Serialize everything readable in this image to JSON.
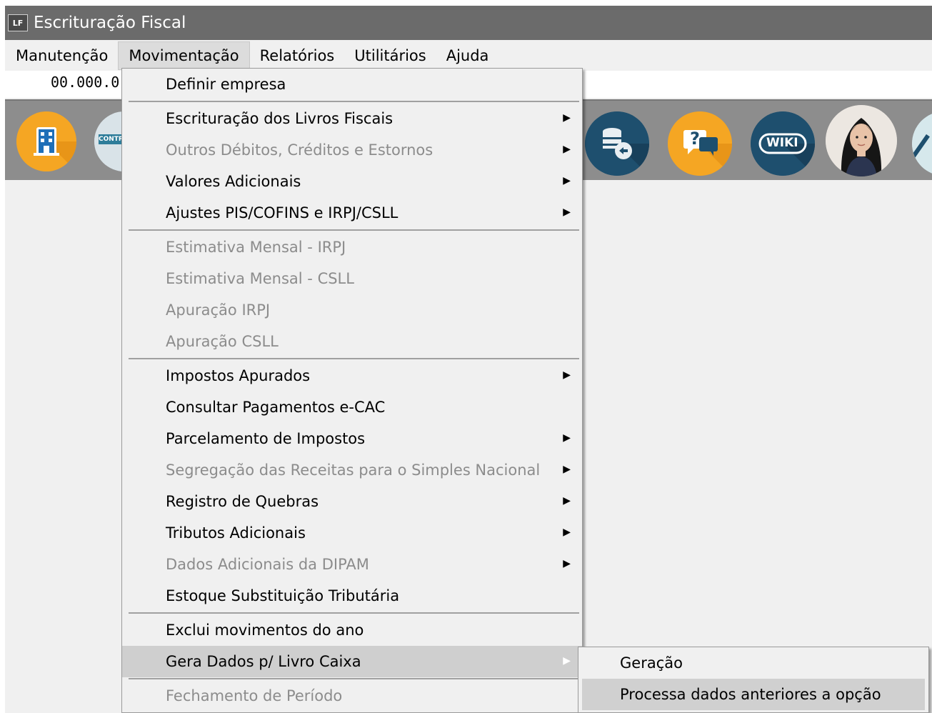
{
  "window": {
    "icon_text": "LF",
    "title": "Escrituração Fiscal"
  },
  "menubar": {
    "items": [
      {
        "label": "Manutenção"
      },
      {
        "label": "Movimentação"
      },
      {
        "label": "Relatórios"
      },
      {
        "label": "Utilitários"
      },
      {
        "label": "Ajuda"
      }
    ],
    "active": "Movimentação"
  },
  "infobar": {
    "company_code": "00.000.0"
  },
  "toolbar": {
    "buttons": [
      {
        "icon": "company-building-icon"
      },
      {
        "icon": "contract-icon",
        "text": "CONTR"
      },
      {
        "icon": "database-return-icon"
      },
      {
        "icon": "help-chat-icon",
        "text": "?"
      },
      {
        "icon": "wiki-icon",
        "text": "WIKI"
      },
      {
        "icon": "assistant-avatar-icon"
      },
      {
        "icon": "tool-icon"
      }
    ]
  },
  "movimentacao_menu": {
    "groups": [
      [
        {
          "label": "Definir empresa",
          "enabled": true,
          "submenu": false
        }
      ],
      [
        {
          "label": "Escrituração dos Livros Fiscais",
          "enabled": true,
          "submenu": true
        },
        {
          "label": "Outros Débitos, Créditos e Estornos",
          "enabled": false,
          "submenu": true
        },
        {
          "label": "Valores Adicionais",
          "enabled": true,
          "submenu": true
        },
        {
          "label": "Ajustes PIS/COFINS e IRPJ/CSLL",
          "enabled": true,
          "submenu": true
        }
      ],
      [
        {
          "label": "Estimativa Mensal - IRPJ",
          "enabled": false,
          "submenu": false
        },
        {
          "label": "Estimativa Mensal - CSLL",
          "enabled": false,
          "submenu": false
        },
        {
          "label": "Apuração IRPJ",
          "enabled": false,
          "submenu": false
        },
        {
          "label": "Apuração CSLL",
          "enabled": false,
          "submenu": false
        }
      ],
      [
        {
          "label": "Impostos Apurados",
          "enabled": true,
          "submenu": true
        },
        {
          "label": "Consultar Pagamentos e-CAC",
          "enabled": true,
          "submenu": false
        },
        {
          "label": "Parcelamento de Impostos",
          "enabled": true,
          "submenu": true
        },
        {
          "label": "Segregação das Receitas para o Simples Nacional",
          "enabled": false,
          "submenu": true
        },
        {
          "label": "Registro de Quebras",
          "enabled": true,
          "submenu": true
        },
        {
          "label": "Tributos Adicionais",
          "enabled": true,
          "submenu": true
        },
        {
          "label": "Dados Adicionais da DIPAM",
          "enabled": false,
          "submenu": true
        },
        {
          "label": "Estoque Substituição Tributária",
          "enabled": true,
          "submenu": false
        }
      ],
      [
        {
          "label": "Exclui movimentos do ano",
          "enabled": true,
          "submenu": false
        },
        {
          "label": "Gera Dados p/ Livro Caixa",
          "enabled": true,
          "submenu": true,
          "highlighted": true
        }
      ],
      [
        {
          "label": "Fechamento de Período",
          "enabled": false,
          "submenu": false
        }
      ]
    ]
  },
  "livro_caixa_submenu": {
    "items": [
      {
        "label": "Geração",
        "highlighted": false
      },
      {
        "label": "Processa dados anteriores a opção",
        "highlighted": true
      }
    ]
  },
  "colors": {
    "title_bar": "#6b6b6b",
    "toolbar_bg": "#8d8d8d",
    "menu_bg": "#f0f0f0",
    "disabled_text": "#8c8c8c",
    "highlight": "#cfcfcf"
  }
}
